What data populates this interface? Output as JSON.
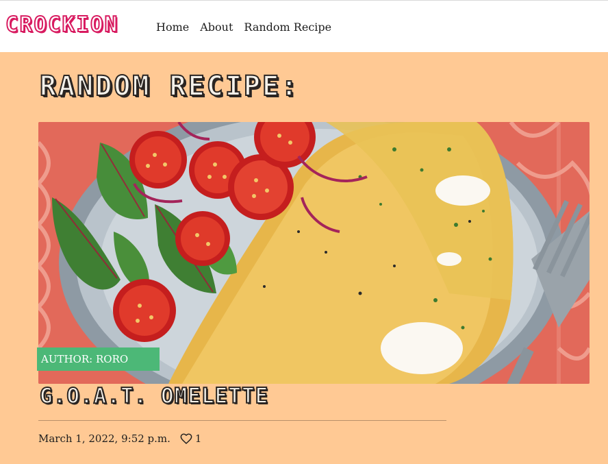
{
  "header": {
    "logo_text": "CROCKION",
    "nav": [
      {
        "label": "Home"
      },
      {
        "label": "About"
      },
      {
        "label": "Random Recipe"
      }
    ]
  },
  "main": {
    "page_title": "RANDOM RECIPE:",
    "recipe": {
      "image_description_icon": "omelette-photo",
      "author_badge": "AUTHOR: RORO",
      "title": "G.O.A.T. OMELETTE",
      "date": "March 1, 2022, 9:52 p.m.",
      "likes": "1",
      "like_icon": "heart-icon"
    }
  },
  "colors": {
    "page_background": "#ffc994",
    "header_background": "#ffffff",
    "logo_accent": "#d81b60",
    "author_badge": "#4cb877",
    "title_outline": "#2a2522"
  }
}
